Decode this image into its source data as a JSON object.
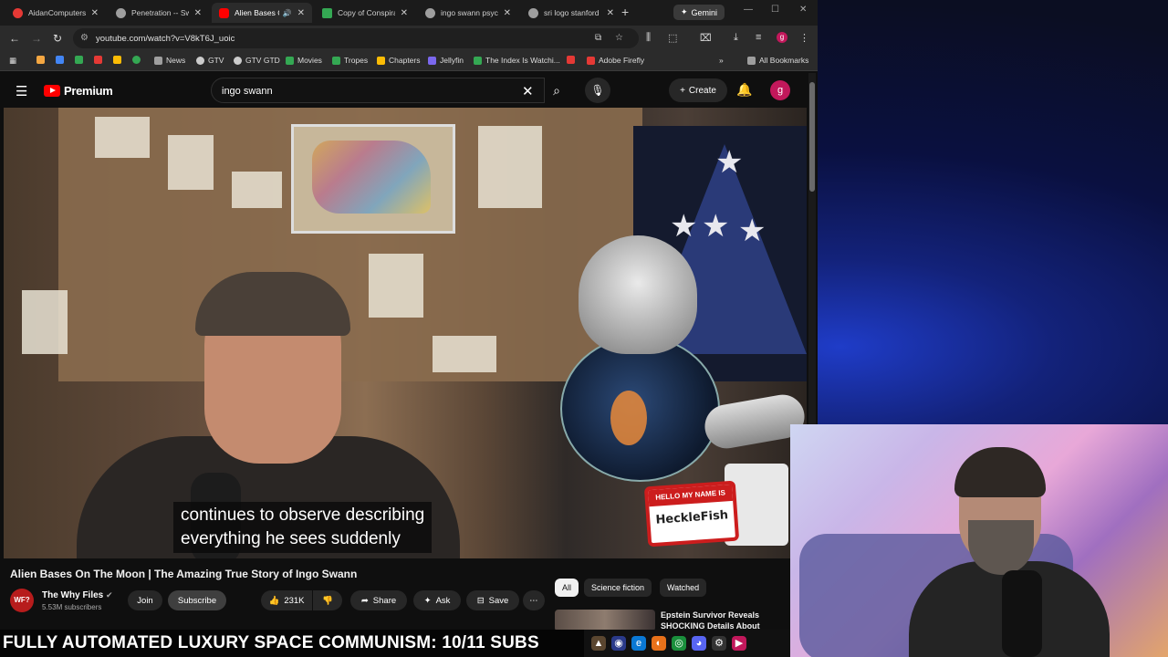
{
  "tabs": [
    {
      "label": "AidanComputers",
      "color": "#e53935"
    },
    {
      "label": "Penetration -- Swi",
      "color": "#9e9e9e"
    },
    {
      "label": "Alien Bases Or",
      "color": "#ff0000"
    },
    {
      "label": "Copy of Conspirac",
      "color": "#34a853"
    },
    {
      "label": "ingo swann psych",
      "color": "#9e9e9e"
    },
    {
      "label": "sri logo stanford",
      "color": "#9e9e9e"
    }
  ],
  "gemini_label": "Gemini",
  "url": "youtube.com/watch?v=V8kT6J_uoic",
  "profile_initial": "g",
  "bookmarks": [
    {
      "label": "",
      "color": "#f4a742"
    },
    {
      "label": "",
      "color": "#4285f4"
    },
    {
      "label": "",
      "color": "#34a853"
    },
    {
      "label": "",
      "color": "#e53935"
    },
    {
      "label": "",
      "color": "#fbbc05"
    },
    {
      "label": "",
      "color": "#34a853"
    },
    {
      "label": "News",
      "color": "#9e9e9e"
    },
    {
      "label": "GTV",
      "color": "#cccccc"
    },
    {
      "label": "GTV GTD",
      "color": "#cccccc"
    },
    {
      "label": "Movies",
      "color": "#34a853"
    },
    {
      "label": "Tropes",
      "color": "#34a853"
    },
    {
      "label": "Chapters",
      "color": "#fbbc05"
    },
    {
      "label": "Jellyfin",
      "color": "#7b68ee"
    },
    {
      "label": "The Index Is Watchi...",
      "color": "#34a853"
    },
    {
      "label": "",
      "color": "#e53935"
    },
    {
      "label": "Adobe Firefly",
      "color": "#e53935"
    }
  ],
  "all_bookmarks": "All Bookmarks",
  "youtube": {
    "logo_text": "Premium",
    "search_value": "ingo swann",
    "create_label": "Create",
    "avatar_initial": "g",
    "caption_line1": "continues to observe describing",
    "caption_line2": "everything he sees suddenly",
    "sign_top": "HELLO MY NAME IS",
    "sign_name": "HeckleFish",
    "video_title": "Alien Bases On The Moon | The Amazing True Story of Ingo Swann",
    "channel_avatar": "WF?",
    "channel_name": "The Why Files",
    "subscribers": "5.53M subscribers",
    "join": "Join",
    "subscribe": "Subscribe",
    "likes": "231K",
    "share": "Share",
    "ask": "Ask",
    "save": "Save",
    "chips": [
      "All",
      "Science fiction",
      "Watched"
    ],
    "rec_title": "Epstein Survivor Reveals SHOCKING Details About"
  },
  "ticker": "FULLY AUTOMATED LUXURY SPACE COMMUNISM: 10/11 SUBS"
}
